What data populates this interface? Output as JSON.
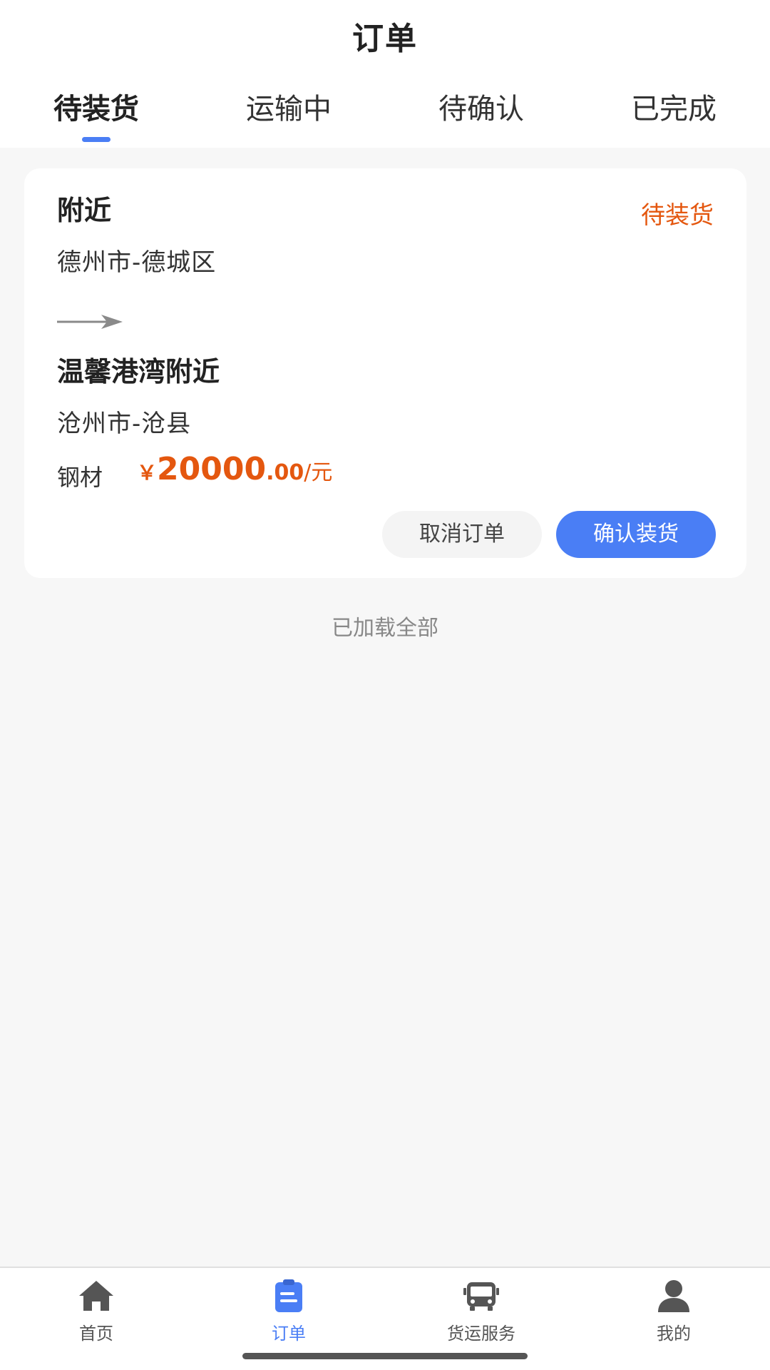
{
  "header": {
    "title": "订单"
  },
  "tabs": [
    {
      "label": "待装货"
    },
    {
      "label": "运输中"
    },
    {
      "label": "待确认"
    },
    {
      "label": "已完成"
    }
  ],
  "order": {
    "from_place": "附近",
    "from_city": "德州市-德城区",
    "to_place": "温馨港湾附近",
    "to_city": "沧州市-沧县",
    "status": "待装货",
    "goods": "钢材",
    "price_currency": "￥",
    "price_integer": "20000",
    "price_decimal": ".00",
    "price_unit": "/元",
    "cancel_label": "取消订单",
    "confirm_label": "确认装货"
  },
  "list_footer": "已加载全部",
  "bottom_nav": [
    {
      "label": "首页",
      "icon": "home-icon"
    },
    {
      "label": "订单",
      "icon": "order-icon"
    },
    {
      "label": "货运服务",
      "icon": "truck-icon"
    },
    {
      "label": "我的",
      "icon": "user-icon"
    }
  ],
  "colors": {
    "accent": "#4a7ef5",
    "status": "#e4570f",
    "background": "#f7f7f7"
  }
}
